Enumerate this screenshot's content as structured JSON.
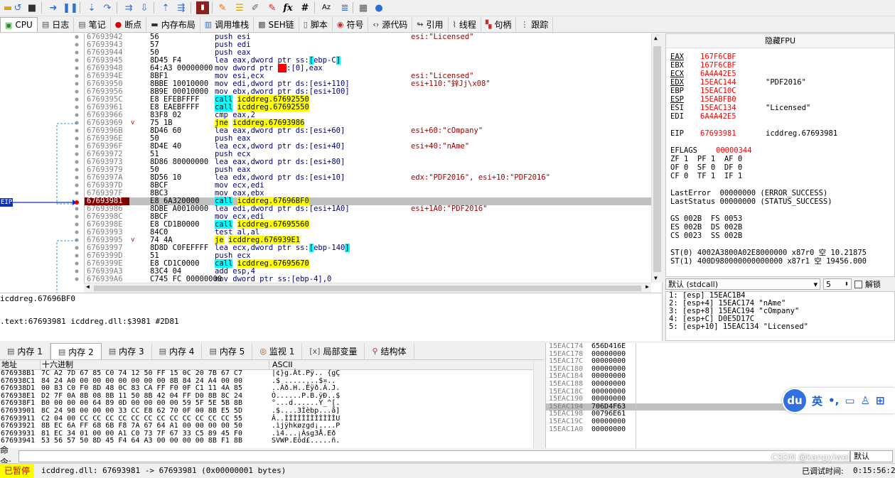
{
  "toolbar": {
    "icons": [
      "folder-icon",
      "restart-icon",
      "close-icon",
      "run-icon",
      "pause-icon",
      "step-into-icon",
      "step-over-icon",
      "trace-into-icon",
      "trace-over-icon",
      "execute-till-return-icon",
      "run-to-user-code-icon",
      "patch-icon",
      "comment-icon",
      "label-icon",
      "bookmark-icon",
      "breakpoint-icon",
      "expression-icon",
      "hash-icon",
      "font-icon",
      "calculator-icon",
      "globe-icon"
    ],
    "fx": "fx",
    "hash": "#",
    "az": "Az"
  },
  "tabs": [
    {
      "label": "CPU",
      "icon": "cpu-icon"
    },
    {
      "label": "日志",
      "icon": "log-icon"
    },
    {
      "label": "笔记",
      "icon": "notes-icon"
    },
    {
      "label": "断点",
      "icon": "breakpoint-icon"
    },
    {
      "label": "内存布局",
      "icon": "memory-map-icon"
    },
    {
      "label": "调用堆栈",
      "icon": "call-stack-icon"
    },
    {
      "label": "SEH链",
      "icon": "seh-icon"
    },
    {
      "label": "脚本",
      "icon": "script-icon"
    },
    {
      "label": "符号",
      "icon": "symbols-icon"
    },
    {
      "label": "源代码",
      "icon": "source-icon"
    },
    {
      "label": "引用",
      "icon": "references-icon"
    },
    {
      "label": "线程",
      "icon": "threads-icon"
    },
    {
      "label": "句柄",
      "icon": "handles-icon"
    },
    {
      "label": "跟踪",
      "icon": "trace-icon"
    }
  ],
  "gutter": {
    "eip_label": "EIP"
  },
  "disasm": [
    {
      "a": "67693942",
      "b": "56",
      "arrow": "",
      "i": [
        [
          "t",
          "push esi"
        ]
      ],
      "c": "esi:\"Licensed\""
    },
    {
      "a": "67693943",
      "b": "57",
      "arrow": "",
      "i": [
        [
          "t",
          "push edi"
        ]
      ],
      "c": ""
    },
    {
      "a": "67693944",
      "b": "50",
      "arrow": "",
      "i": [
        [
          "t",
          "push eax"
        ]
      ],
      "c": ""
    },
    {
      "a": "67693945",
      "b": "8D45 F4",
      "arrow": "",
      "i": [
        [
          "t",
          "lea eax,dword ptr ss:"
        ],
        [
          "br",
          "["
        ],
        [
          "t",
          "ebp-C"
        ],
        [
          "br",
          "]"
        ]
      ],
      "c": ""
    },
    {
      "a": "67693948",
      "b": "64:A3 00000000",
      "arrow": "",
      "i": [
        [
          "t",
          "mov dword ptr "
        ],
        [
          "seg",
          "fs"
        ],
        [
          "t",
          ":[0],eax"
        ]
      ],
      "c": ""
    },
    {
      "a": "6769394E",
      "b": "8BF1",
      "arrow": "",
      "i": [
        [
          "t",
          "mov esi,ecx"
        ]
      ],
      "c": "esi:\"Licensed\""
    },
    {
      "a": "67693950",
      "b": "8BBE 10010000",
      "arrow": "",
      "i": [
        [
          "t",
          "mov edi,dword ptr ds:[esi+110]"
        ]
      ],
      "c": "esi+110:\"鋅Jj\\x08\""
    },
    {
      "a": "67693956",
      "b": "8B9E 00010000",
      "arrow": "",
      "i": [
        [
          "t",
          "mov ebx,dword ptr ds:[esi+100]"
        ]
      ],
      "c": ""
    },
    {
      "a": "6769395C",
      "b": "E8 EFEBFFFF",
      "arrow": "",
      "i": [
        [
          "call",
          "call"
        ],
        [
          "t",
          " "
        ],
        [
          "tgt",
          "icddreg.67692550"
        ]
      ],
      "c": ""
    },
    {
      "a": "67693961",
      "b": "E8 EAEBFFFF",
      "arrow": "",
      "i": [
        [
          "call",
          "call"
        ],
        [
          "t",
          " "
        ],
        [
          "tgt",
          "icddreg.67692550"
        ]
      ],
      "c": ""
    },
    {
      "a": "67693966",
      "b": "83F8 02",
      "arrow": "",
      "i": [
        [
          "t",
          "cmp eax,2"
        ]
      ],
      "c": ""
    },
    {
      "a": "67693969",
      "b": "75 1B",
      "arrow": "v",
      "i": [
        [
          "j",
          "jne"
        ],
        [
          "t",
          " "
        ],
        [
          "tgt",
          "icddreg.67693986"
        ]
      ],
      "c": ""
    },
    {
      "a": "6769396B",
      "b": "8D46 60",
      "arrow": "",
      "i": [
        [
          "t",
          "lea eax,dword ptr ds:[esi+60]"
        ]
      ],
      "c": "esi+60:\"cOmpany\""
    },
    {
      "a": "6769396E",
      "b": "50",
      "arrow": "",
      "i": [
        [
          "t",
          "push eax"
        ]
      ],
      "c": ""
    },
    {
      "a": "6769396F",
      "b": "8D4E 40",
      "arrow": "",
      "i": [
        [
          "t",
          "lea ecx,dword ptr ds:[esi+40]"
        ]
      ],
      "c": "esi+40:\"nAme\""
    },
    {
      "a": "67693972",
      "b": "51",
      "arrow": "",
      "i": [
        [
          "t",
          "push ecx"
        ]
      ],
      "c": ""
    },
    {
      "a": "67693973",
      "b": "8D86 80000000",
      "arrow": "",
      "i": [
        [
          "t",
          "lea eax,dword ptr ds:[esi+80]"
        ]
      ],
      "c": ""
    },
    {
      "a": "67693979",
      "b": "50",
      "arrow": "",
      "i": [
        [
          "t",
          "push eax"
        ]
      ],
      "c": ""
    },
    {
      "a": "6769397A",
      "b": "8D56 10",
      "arrow": "",
      "i": [
        [
          "t",
          "lea edx,dword ptr ds:[esi+10]"
        ]
      ],
      "c": "edx:\"PDF2016\", esi+10:\"PDF2016\""
    },
    {
      "a": "6769397D",
      "b": "8BCF",
      "arrow": "",
      "i": [
        [
          "t",
          "mov ecx,edi"
        ]
      ],
      "c": ""
    },
    {
      "a": "6769397F",
      "b": "8BC3",
      "arrow": "",
      "i": [
        [
          "t",
          "mov eax,ebx"
        ]
      ],
      "c": ""
    },
    {
      "a": "67693981",
      "b": "E8 6A320000",
      "arrow": "",
      "cur": true,
      "i": [
        [
          "call",
          "call"
        ],
        [
          "t",
          " "
        ],
        [
          "tgt",
          "icddreg.67696BF0"
        ]
      ],
      "c": ""
    },
    {
      "a": "67693986",
      "b": "8DBE A0010000",
      "arrow": "",
      "i": [
        [
          "t",
          "lea edi,dword ptr ds:[esi+1A0]"
        ]
      ],
      "c": "esi+1A0:\"PDF2016\""
    },
    {
      "a": "6769398C",
      "b": "8BCF",
      "arrow": "",
      "i": [
        [
          "t",
          "mov ecx,edi"
        ]
      ],
      "c": ""
    },
    {
      "a": "6769398E",
      "b": "E8 CD1B0000",
      "arrow": "",
      "i": [
        [
          "call",
          "call"
        ],
        [
          "t",
          " "
        ],
        [
          "tgt",
          "icddreg.67695560"
        ]
      ],
      "c": ""
    },
    {
      "a": "67693993",
      "b": "84C0",
      "arrow": "",
      "i": [
        [
          "t",
          "test al,al"
        ]
      ],
      "c": ""
    },
    {
      "a": "67693995",
      "b": "74 4A",
      "arrow": "v",
      "i": [
        [
          "j",
          "je"
        ],
        [
          "t",
          " "
        ],
        [
          "tgt",
          "icddreg.676939E1"
        ]
      ],
      "c": ""
    },
    {
      "a": "67693997",
      "b": "8D8D C0FEFFFF",
      "arrow": "",
      "i": [
        [
          "t",
          "lea ecx,dword ptr ss:"
        ],
        [
          "br",
          "["
        ],
        [
          "t",
          "ebp-140"
        ],
        [
          "br",
          "]"
        ]
      ],
      "c": ""
    },
    {
      "a": "6769399D",
      "b": "51",
      "arrow": "",
      "i": [
        [
          "t",
          "push ecx"
        ]
      ],
      "c": ""
    },
    {
      "a": "6769399E",
      "b": "E8 CD1C0000",
      "arrow": "",
      "i": [
        [
          "call",
          "call"
        ],
        [
          "t",
          " "
        ],
        [
          "tgt",
          "icddreg.67695670"
        ]
      ],
      "c": ""
    },
    {
      "a": "676939A3",
      "b": "83C4 04",
      "arrow": "",
      "i": [
        [
          "t",
          "add esp,4"
        ]
      ],
      "c": ""
    },
    {
      "a": "676939A6",
      "b": "C745 FC 00000000",
      "arrow": "",
      "i": [
        [
          "t",
          "mov dword ptr ss:[ebp-4],0"
        ]
      ],
      "c": ""
    }
  ],
  "registers": {
    "header": "隐藏FPU",
    "lines": [
      {
        "n": "EAX",
        "v": "167F6CBF",
        "ul": true,
        "x": ""
      },
      {
        "n": "EBX",
        "v": "167F6CBF",
        "ul": false,
        "x": ""
      },
      {
        "n": "ECX",
        "v": "6A4A42E5",
        "ul": true,
        "x": ""
      },
      {
        "n": "EDX",
        "v": "15EAC144",
        "ul": true,
        "x": "\"PDF2016\""
      },
      {
        "n": "EBP",
        "v": "15EAC10C",
        "ul": false,
        "x": ""
      },
      {
        "n": "ESP",
        "v": "15EABFB0",
        "ul": true,
        "x": ""
      },
      {
        "n": "ESI",
        "v": "15EAC134",
        "ul": false,
        "x": "\"Licensed\""
      },
      {
        "n": "EDI",
        "v": "6A4A42E5",
        "ul": false,
        "x": ""
      },
      {
        "n": "",
        "v": "",
        "ul": false,
        "x": ""
      },
      {
        "n": "EIP",
        "v": "67693981",
        "ul": false,
        "x": "icddreg.67693981"
      },
      {
        "n": "",
        "v": "",
        "ul": false,
        "x": ""
      },
      {
        "n": "EFLAGS",
        "v": "00000344",
        "ul": false,
        "x": ""
      }
    ],
    "flags": [
      "ZF 1  PF 1  AF 0",
      "OF 0  SF 0  DF 0",
      "CF 0  TF 1  IF 1"
    ],
    "last_error": "LastError  00000000 (ERROR_SUCCESS)",
    "last_status": "LastStatus 00000000 (STATUS_SUCCESS)",
    "segs": [
      "GS 002B  FS 0053",
      "ES 002B  DS 002B",
      "CS 0023  SS 002B"
    ],
    "fpu": [
      "ST(0) 4002A3800A02E8000000 x87r0 空 10.21875",
      "ST(1) 400D980000000000000 x87r1 空 19456.000"
    ]
  },
  "callconv": {
    "value": "默认 (stdcall)",
    "count": "5",
    "unwind": "解锁"
  },
  "stackargs": [
    "1: [esp] 15EAC1B4",
    "2: [esp+4] 15EAC174 \"nAme\"",
    "3: [esp+8] 15EAC194 \"cOmpany\"",
    "4: [esp+C] D0E5D17C",
    "5: [esp+10] 15EAC134 \"Licensed\""
  ],
  "info": {
    "line1": "icddreg.67696BF0",
    "line2": ".text:67693981 icddreg.dll:$3981 #2D81"
  },
  "memtabs": [
    "内存 1",
    "内存 2",
    "内存 3",
    "内存 4",
    "内存 5",
    "监视 1",
    "局部变量",
    "结构体"
  ],
  "dump": {
    "h_addr": "地址",
    "h_hex": "十六进制",
    "h_ascii": "ASCII",
    "rows": [
      {
        "a": "676938B1",
        "h": "7C A2 7D 67 85 C0 74 12 50 FF 15 0C 20 7B 67 C7",
        "s": "|¢}g.Àt.Pÿ.. {gÇ"
      },
      {
        "a": "676938C1",
        "h": "84 24 A0 00 00 00 00 00 00 00 8B 84 24 A4 00 00",
        "s": ".$ ........$¤.."
      },
      {
        "a": "676938D1",
        "h": "00 83 C0 F0 8D 48 0C 83 CA FF F0 0F C1 11 4A 85",
        "s": "..Àð.H..Êÿð.Á.J."
      },
      {
        "a": "676938E1",
        "h": "D2 7F 0A 8B 08 8B 11 50 8B 42 04 FF D0 8B 8C 24",
        "s": "Ò......P.B.ÿÐ..$"
      },
      {
        "a": "676938F1",
        "h": "B0 00 00 00 64 89 0D 00 00 00 00 59 5F 5E 5B 8B",
        "s": "°...d......Y_^[."
      },
      {
        "a": "67693901",
        "h": "8C 24 98 00 00 00 33 CC E8 62 70 0F 00 8B E5 5D",
        "s": ".$....3Ìèbp...å]"
      },
      {
        "a": "67693911",
        "h": "C2 04 00 CC CC CC CC CC CC CC CC CC CC CC CC 55",
        "s": "Â..ÌÌÌÌÌÌÌÌÌÌÌÌU"
      },
      {
        "a": "67693921",
        "h": "8B EC 6A FF 68 6B F8 7A 67 64 A1 00 00 00 00 50",
        "s": ".ìjÿhkøzgd¡....P"
      },
      {
        "a": "67693931",
        "h": "81 EC 34 01 00 00 A1 C0 73 7F 67 33 C5 89 45 F0",
        "s": ".ì4...¡Àsg3Å.Eð"
      },
      {
        "a": "67693941",
        "h": "53 56 57 50 8D 45 F4 64 A3 00 00 00 00 8B F1 8B",
        "s": "SVWP.Eôd£.....ñ."
      }
    ]
  },
  "stack": [
    {
      "a": "15EAC174",
      "v": "656D416E",
      "hl": false
    },
    {
      "a": "15EAC178",
      "v": "00000000",
      "hl": false
    },
    {
      "a": "15EAC17C",
      "v": "00000000",
      "hl": false
    },
    {
      "a": "15EAC180",
      "v": "00000000",
      "hl": false
    },
    {
      "a": "15EAC184",
      "v": "00000000",
      "hl": false
    },
    {
      "a": "15EAC188",
      "v": "00000000",
      "hl": false
    },
    {
      "a": "15EAC18C",
      "v": "00000000",
      "hl": false
    },
    {
      "a": "15EAC190",
      "v": "00000000",
      "hl": false
    },
    {
      "a": "15EAC194",
      "v": "706D4F63",
      "hl": true
    },
    {
      "a": "15EAC198",
      "v": "00796E61",
      "hl": false
    },
    {
      "a": "15EAC19C",
      "v": "00000000",
      "hl": false
    },
    {
      "a": "15EAC1A0",
      "v": "00000000",
      "hl": false
    }
  ],
  "baidu": {
    "logo": "du",
    "lang": "英",
    "marks": "•,"
  },
  "cmd": {
    "label": "命令:",
    "mode": "默认"
  },
  "status": {
    "paused": "已暂停",
    "msg": "icddreg.dll: 67693981 -> 67693981 (0x00000001 bytes)",
    "watermark": "CSDN @kangyiwei",
    "time_label": "已调试时间:",
    "time": "0:15:56:2"
  }
}
